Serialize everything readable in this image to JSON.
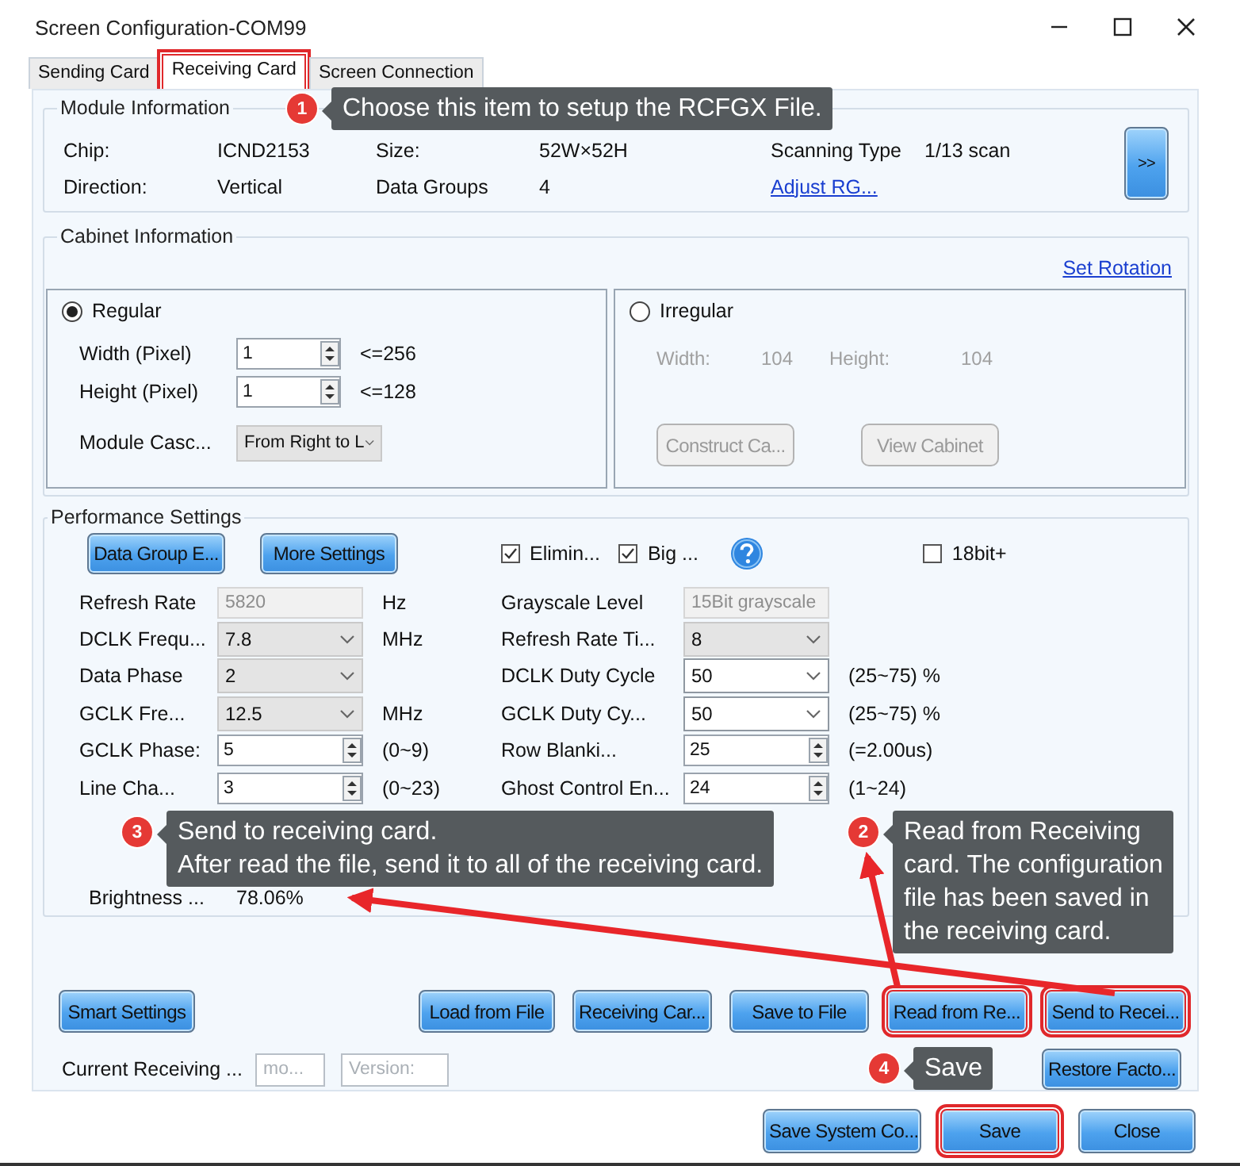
{
  "window": {
    "title": "Screen Configuration-COM99"
  },
  "tabs": [
    {
      "label": "Sending Card",
      "selected": false,
      "highlighted": false
    },
    {
      "label": "Receiving Card",
      "selected": true,
      "highlighted": true
    },
    {
      "label": "Screen Connection",
      "selected": false,
      "highlighted": false
    }
  ],
  "module_information": {
    "title": "Module Information",
    "fields": [
      {
        "label": "Chip:",
        "value": "ICND2153"
      },
      {
        "label": "Size:",
        "value": "52W×52H"
      },
      {
        "label": "Scanning Type",
        "value": "1/13 scan"
      },
      {
        "label": "Direction:",
        "value": "Vertical"
      },
      {
        "label": "Data Groups",
        "value": "4"
      }
    ],
    "link": "Adjust RG...",
    "more_button": ">>"
  },
  "cabinet_information": {
    "title": "Cabinet Information",
    "link": "Set Rotation",
    "regular": {
      "label": "Regular",
      "selected": true,
      "rows": [
        {
          "label": "Width (Pixel)",
          "value": "1",
          "hint": "<=256"
        },
        {
          "label": "Height (Pixel)",
          "value": "1",
          "hint": "<=128"
        }
      ],
      "cascade": {
        "label": "Module Casc...",
        "value": "From Right to L"
      }
    },
    "irregular": {
      "label": "Irregular",
      "selected": false,
      "disabled": true,
      "fields": [
        {
          "label": "Width:",
          "value": "104"
        },
        {
          "label": "Height:",
          "value": "104"
        }
      ],
      "buttons": [
        "Construct Ca...",
        "View Cabinet"
      ]
    }
  },
  "performance_settings": {
    "title": "Performance Settings",
    "buttons": [
      "Data Group E...",
      "More Settings"
    ],
    "checkboxes": [
      {
        "label": "Elimin...",
        "checked": true
      },
      {
        "label": "Big ...",
        "checked": true
      },
      {
        "label": "18bit+",
        "checked": false
      }
    ],
    "left_rows": [
      {
        "label": "Refresh Rate",
        "kind": "readonly",
        "value": "5820",
        "unit": "Hz"
      },
      {
        "label": "DCLK Frequ...",
        "kind": "dropdown",
        "value": "7.8",
        "unit": "MHz"
      },
      {
        "label": "Data Phase",
        "kind": "dropdown",
        "value": "2"
      },
      {
        "label": "GCLK Fre...",
        "kind": "dropdown",
        "value": "12.5",
        "unit": "MHz"
      },
      {
        "label": "GCLK Phase:",
        "kind": "spin",
        "value": "5",
        "unit": "(0~9)"
      },
      {
        "label": "Line Cha...",
        "kind": "spin",
        "value": "3",
        "unit": "(0~23)"
      }
    ],
    "right_rows": [
      {
        "label": "Grayscale Level",
        "kind": "readonly",
        "value": "15Bit grayscale"
      },
      {
        "label": "Refresh Rate Ti...",
        "kind": "dropdown",
        "value": "8"
      },
      {
        "label": "DCLK Duty Cycle",
        "kind": "select",
        "value": "50",
        "unit": "(25~75) %"
      },
      {
        "label": "GCLK Duty Cy...",
        "kind": "select",
        "value": "50",
        "unit": "(25~75) %"
      },
      {
        "label": "Row Blanki...",
        "kind": "spin",
        "value": "25",
        "unit": "(=2.00us)"
      },
      {
        "label": "Ghost Control En...",
        "kind": "spin",
        "value": "24",
        "unit": "(1~24)"
      }
    ],
    "brightness": {
      "label": "Brightness ...",
      "value": "78.06%"
    }
  },
  "action_buttons": [
    {
      "label": "Smart Settings",
      "highlighted": false
    },
    {
      "label": "Load from File",
      "highlighted": false
    },
    {
      "label": "Receiving Car...",
      "highlighted": false
    },
    {
      "label": "Save to File",
      "highlighted": false
    },
    {
      "label": "Read from Re...",
      "highlighted": true
    },
    {
      "label": "Send to Recei...",
      "highlighted": true
    }
  ],
  "current_receiving": {
    "label": "Current Receiving ...",
    "model_placeholder": "mo...",
    "version_placeholder": "Version:"
  },
  "restore_button": {
    "label": "Restore Facto...",
    "highlighted": false
  },
  "footer_buttons": [
    {
      "label": "Save System Co...",
      "highlighted": false
    },
    {
      "label": "Save",
      "highlighted": true
    },
    {
      "label": "Close",
      "highlighted": false
    }
  ],
  "callouts": [
    {
      "number": "1",
      "lines": [
        "Choose this item to setup the RCFGX File."
      ]
    },
    {
      "number": "3",
      "lines": [
        "Send to receiving card.",
        "After read the file, send it to all of the receiving card."
      ]
    },
    {
      "number": "2",
      "lines": [
        "Read from Receiving",
        "card. The configuration",
        "file has been saved in",
        "the receiving card."
      ]
    },
    {
      "number": "4",
      "lines": [
        "Save"
      ]
    }
  ]
}
